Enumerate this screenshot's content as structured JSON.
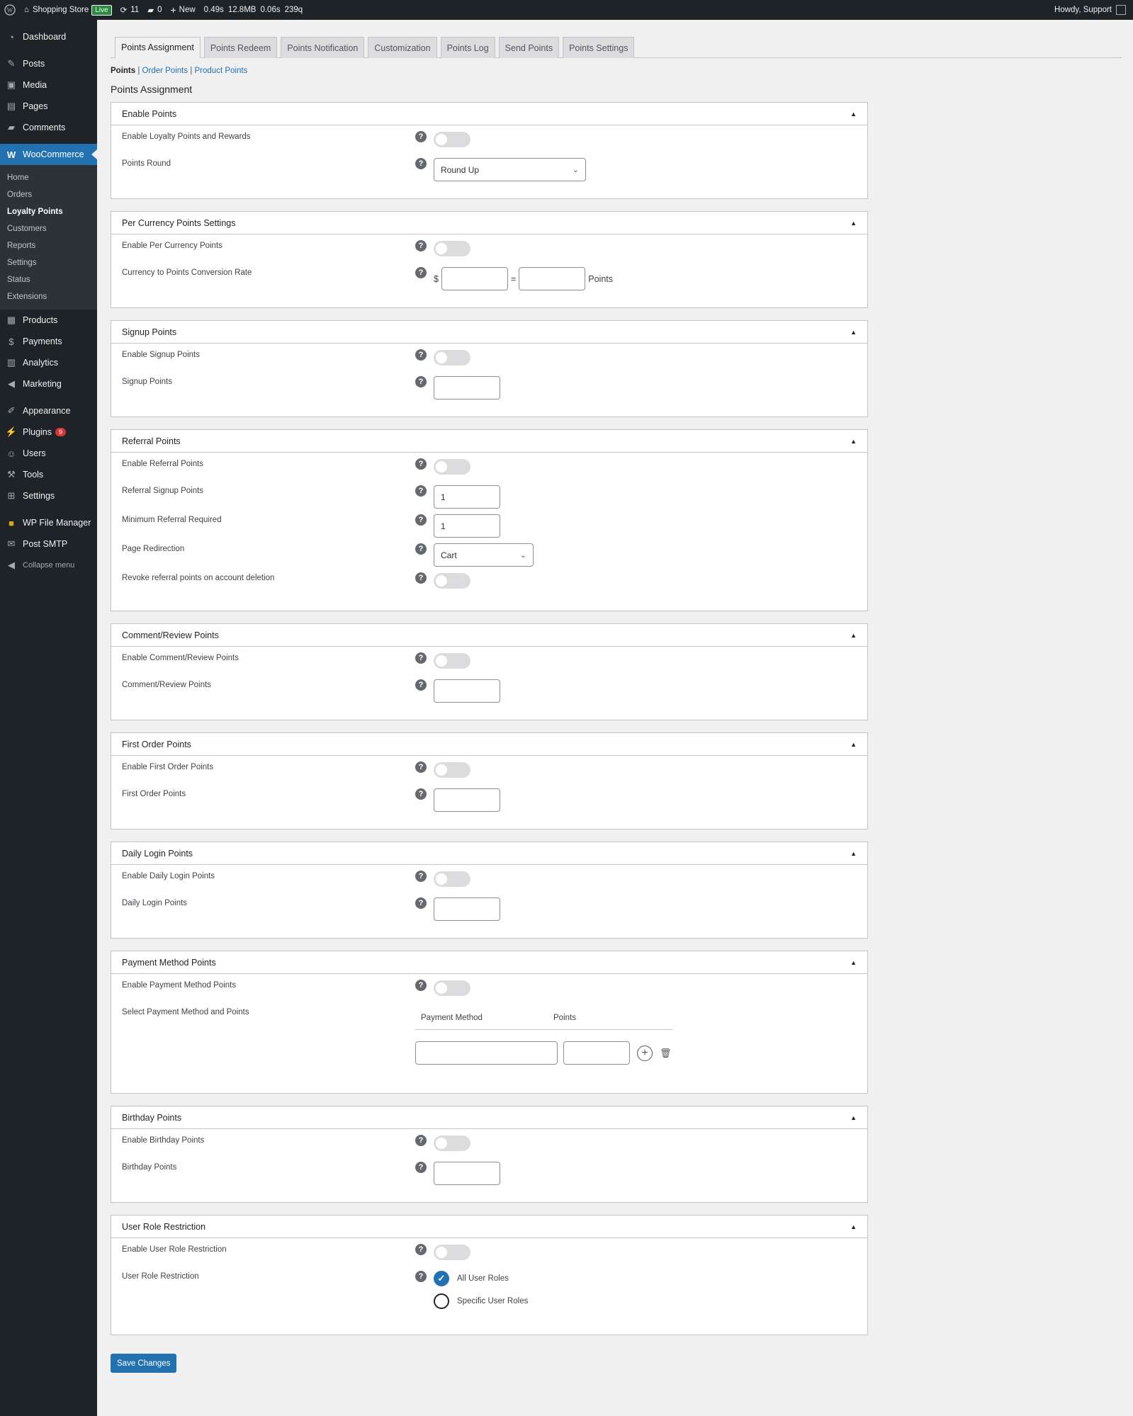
{
  "adminbar": {
    "site_name": "Shopping Store",
    "live_badge": "Live",
    "updates_count": "11",
    "comments_count": "0",
    "new_label": "New",
    "stat_time": "0.49s",
    "stat_mem": "12.8MB",
    "stat_db": "0.06s",
    "stat_queries": "239q",
    "howdy": "Howdy, Support"
  },
  "sidebar": {
    "dashboard": "Dashboard",
    "posts": "Posts",
    "media": "Media",
    "pages": "Pages",
    "comments": "Comments",
    "woocommerce": "WooCommerce",
    "woo_sub": [
      "Home",
      "Orders",
      "Loyalty Points",
      "Customers",
      "Reports",
      "Settings",
      "Status",
      "Extensions"
    ],
    "products": "Products",
    "payments": "Payments",
    "analytics": "Analytics",
    "marketing": "Marketing",
    "appearance": "Appearance",
    "plugins": "Plugins",
    "plugins_badge": "9",
    "users": "Users",
    "tools": "Tools",
    "settings": "Settings",
    "wp_file_manager": "WP File Manager",
    "post_smtp": "Post SMTP",
    "collapse": "Collapse menu"
  },
  "tabs": [
    "Points Assignment",
    "Points Redeem",
    "Points Notification",
    "Customization",
    "Points Log",
    "Send Points",
    "Points Settings"
  ],
  "subnav": {
    "current": "Points",
    "sep": "|",
    "order_points": "Order Points",
    "product_points": "Product Points"
  },
  "page_title": "Points Assignment",
  "help_glyph": "?",
  "panels": {
    "enable_points": {
      "title": "Enable Points",
      "enable_label": "Enable Loyalty Points and Rewards",
      "round_label": "Points Round",
      "round_value": "Round Up"
    },
    "per_currency": {
      "title": "Per Currency Points Settings",
      "enable_label": "Enable Per Currency Points",
      "rate_label": "Currency to Points Conversion Rate",
      "currency_symbol": "$",
      "equals": "=",
      "points_suffix": "Points"
    },
    "signup": {
      "title": "Signup Points",
      "enable_label": "Enable Signup Points",
      "points_label": "Signup Points"
    },
    "referral": {
      "title": "Referral Points",
      "enable_label": "Enable Referral Points",
      "signup_label": "Referral Signup Points",
      "signup_value": "1",
      "min_label": "Minimum Referral Required",
      "min_value": "1",
      "redirect_label": "Page Redirection",
      "redirect_value": "Cart",
      "revoke_label": "Revoke referral points on account deletion"
    },
    "comment": {
      "title": "Comment/Review Points",
      "enable_label": "Enable Comment/Review Points",
      "points_label": "Comment/Review Points"
    },
    "first_order": {
      "title": "First Order Points",
      "enable_label": "Enable First Order Points",
      "points_label": "First Order Points"
    },
    "daily_login": {
      "title": "Daily Login Points",
      "enable_label": "Enable Daily Login Points",
      "points_label": "Daily Login Points"
    },
    "payment_method": {
      "title": "Payment Method Points",
      "enable_label": "Enable Payment Method Points",
      "select_label": "Select Payment Method and Points",
      "col_method": "Payment Method",
      "col_points": "Points"
    },
    "birthday": {
      "title": "Birthday Points",
      "enable_label": "Enable Birthday Points",
      "points_label": "Birthday Points"
    },
    "user_role": {
      "title": "User Role Restriction",
      "enable_label": "Enable User Role Restriction",
      "restriction_label": "User Role Restriction",
      "option_all": "All User Roles",
      "option_specific": "Specific User Roles"
    }
  },
  "save_button": "Save Changes",
  "colors": {
    "accent": "#2271b1",
    "adminbar": "#1d2327",
    "live": "#2a8a3e"
  }
}
